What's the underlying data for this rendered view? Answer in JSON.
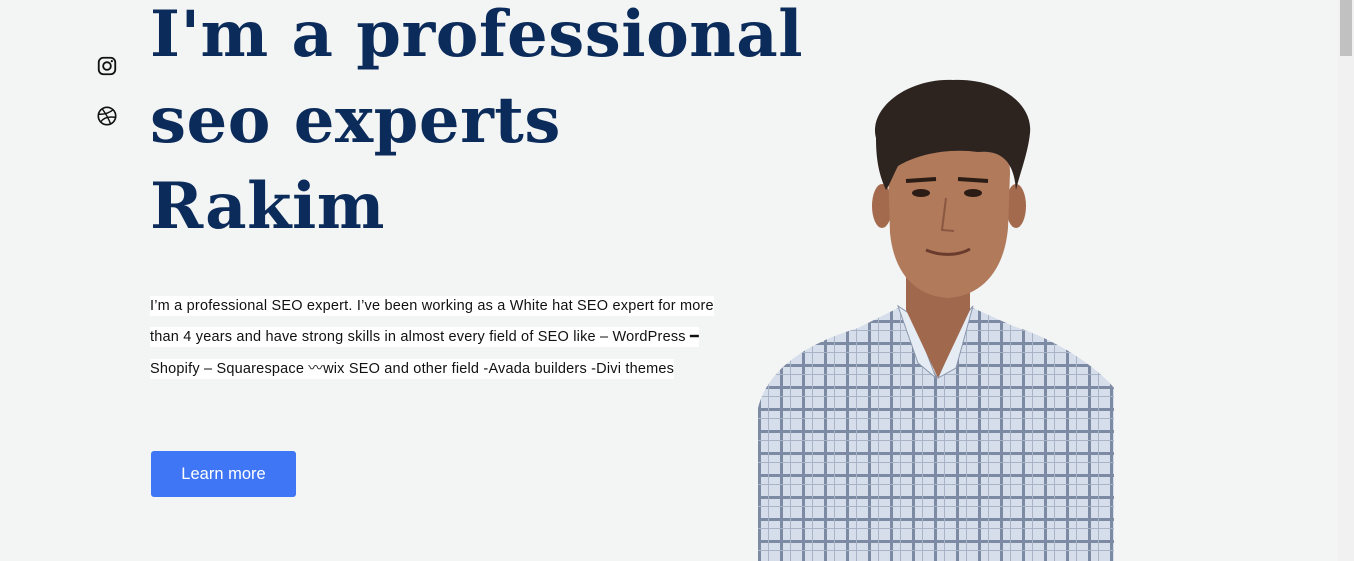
{
  "social": {
    "icons": [
      {
        "name": "instagram-icon"
      },
      {
        "name": "dribbble-icon"
      }
    ]
  },
  "hero": {
    "title_lines": [
      "I'm a professional",
      "seo experts",
      "Rakim"
    ],
    "description": "I’m a professional SEO expert. I’ve been working as a White hat SEO expert for more than 4 years and have strong skills in almost every field of SEO like – WordPress ━ Shopify – Squarespace 〰wix SEO and other field -Avada builders -Divi themes",
    "cta_label": "Learn more"
  },
  "colors": {
    "title": "#0b2b5a",
    "cta": "#3e76f5",
    "background": "#f3f4f4"
  }
}
